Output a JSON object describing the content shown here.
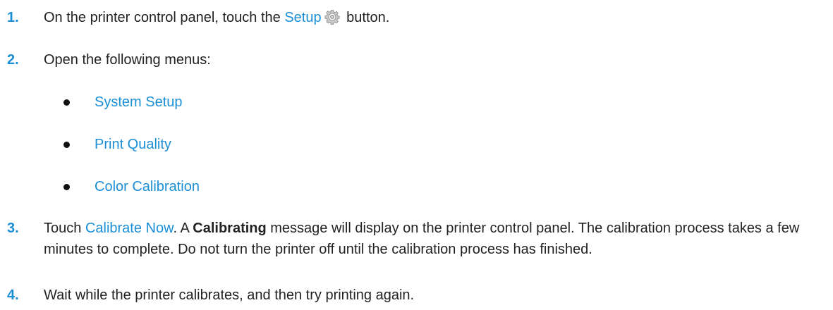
{
  "steps": [
    {
      "number": "1.",
      "text_before": "On the printer control panel, touch the ",
      "link": "Setup",
      "icon": "gear-icon",
      "text_after": " button."
    },
    {
      "number": "2.",
      "text": "Open the following menus:",
      "menus": [
        "System Setup",
        "Print Quality",
        "Color Calibration"
      ]
    },
    {
      "number": "3.",
      "text_before": "Touch ",
      "link": "Calibrate Now",
      "text_mid": ". A ",
      "bold": "Calibrating",
      "text_after": " message will display on the printer control panel. The calibration process takes a few minutes to complete. Do not turn the printer off until the calibration process has finished."
    },
    {
      "number": "4.",
      "text": "Wait while the printer calibrates, and then try printing again."
    }
  ],
  "colors": {
    "accent": "#1b8fd6",
    "text": "#222222"
  }
}
